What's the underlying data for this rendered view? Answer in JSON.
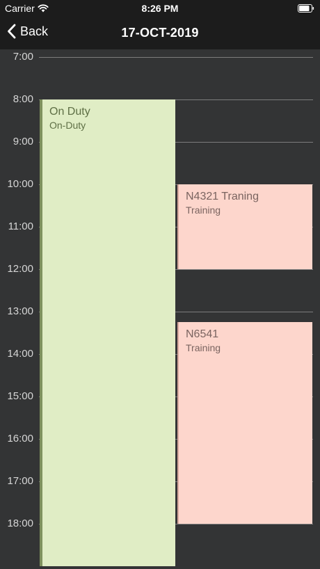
{
  "status_bar": {
    "carrier": "Carrier",
    "time": "8:26 PM",
    "wifi_icon": "wifi-icon",
    "battery_icon": "battery-icon",
    "battery_level_percent": 85
  },
  "nav": {
    "back_label": "Back",
    "back_icon": "chevron-left-icon",
    "title": "17-OCT-2019"
  },
  "calendar": {
    "hours": [
      "7:00",
      "8:00",
      "9:00",
      "10:00",
      "11:00",
      "12:00",
      "13:00",
      "14:00",
      "15:00",
      "16:00",
      "17:00",
      "18:00"
    ],
    "events": [
      {
        "title": "On Duty",
        "subtitle": "On-Duty",
        "start": "8:00",
        "end": "19:00",
        "kind": "duty",
        "color": "#e0edc5"
      },
      {
        "title": "N4321 Traning",
        "subtitle": "Training",
        "start": "10:00",
        "end": "12:00",
        "kind": "training",
        "color": "#fdd6cc"
      },
      {
        "title": "N6541",
        "subtitle": "Training",
        "start": "13:15",
        "end": "18:00",
        "kind": "training",
        "color": "#fdd6cc"
      }
    ]
  },
  "colors": {
    "background": "#333435",
    "bar": "#1c1c1c",
    "grid_line": "#7d7d7d",
    "duty": "#e0edc5",
    "training": "#fdd6cc"
  }
}
